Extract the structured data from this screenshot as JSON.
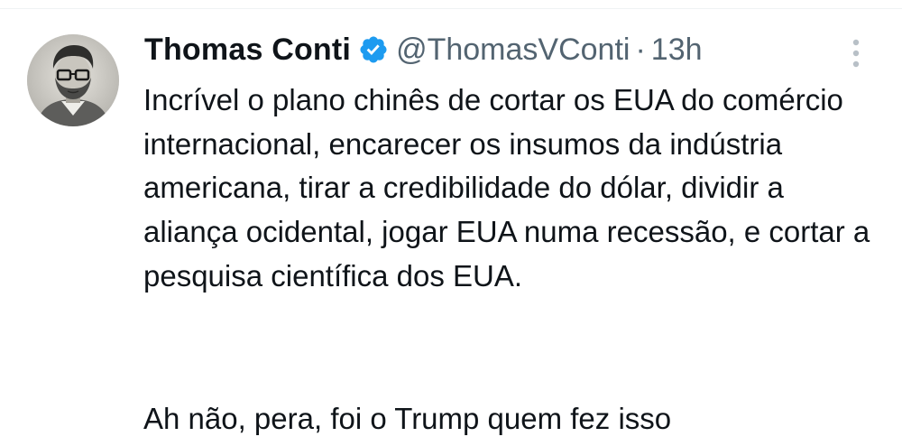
{
  "tweet": {
    "author_name": "Thomas Conti",
    "handle": "@ThomasVConti",
    "separator": "·",
    "time": "13h",
    "verified": true,
    "paragraph1": "Incrível o plano chinês de cortar os EUA do comércio internacional, encarecer os insumos da indústria americana, tirar a credibilidade do dólar, dividir a aliança ocidental, jogar EUA numa recessão, e cortar a pesquisa científica dos EUA.",
    "paragraph2": "Ah não, pera, foi o Trump quem fez isso"
  },
  "icons": {
    "verified": "verified-badge-icon",
    "more": "more-vertical-icon"
  },
  "colors": {
    "verified_blue": "#1d9bf0",
    "secondary_text": "#536471",
    "primary_text": "#0f1419"
  }
}
